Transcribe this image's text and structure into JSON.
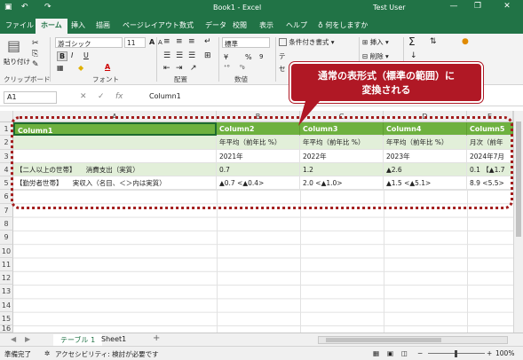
{
  "window": {
    "title": "Book1 - Excel",
    "user": "Test User",
    "minimize_glyph": "—",
    "restore_glyph": "❐",
    "close_glyph": "✕"
  },
  "ribbon_tabs": [
    "ファイル",
    "ホーム",
    "挿入",
    "描画",
    "ページレイアウト",
    "数式",
    "データ",
    "校閲",
    "表示",
    "ヘルプ"
  ],
  "tell_me": "何をしますか",
  "ribbon": {
    "paste_label": "貼り付け",
    "clipboard_label": "クリップボード",
    "font_name": "游ゴシック",
    "font_size": "11",
    "font_group_label": "フォント",
    "align_group_label": "配置",
    "number_format": "標準",
    "number_group_label": "数値",
    "conditional_format": "条件付き書式 ▾",
    "insert_label": "挿入 ▾",
    "delete_label": "削除 ▾",
    "cell_style_short": "セ",
    "table_format_short": "テ",
    "bold": "B",
    "italic": "I",
    "underline": "U",
    "sum_glyph": "Σ",
    "percent": "%",
    "accounting": "¥",
    "increase_font": "A",
    "decrease_font": "A",
    "font_color": "A",
    "fill_color": "◆",
    "accent_color": "#217346"
  },
  "formula_bar": {
    "name_box": "A1",
    "cancel_glyph": "✕",
    "enter_glyph": "✓",
    "fx_label": "fx",
    "content": "Column1"
  },
  "columns": [
    "A",
    "B",
    "C",
    "D",
    "E"
  ],
  "rows": [
    "1",
    "2",
    "3",
    "4",
    "5",
    "6",
    "7",
    "8",
    "9",
    "10",
    "11",
    "12",
    "13",
    "14",
    "15",
    "16"
  ],
  "table": {
    "header": [
      "Column1",
      "Column2",
      "Column3",
      "Column4",
      "Column5"
    ],
    "body": [
      [
        "",
        "年平均（前年比 %）",
        "年平均（前年比 %）",
        "年平均（前年比 %）",
        "月次（前年"
      ],
      [
        "",
        "2021年",
        "2022年",
        "2023年",
        "2024年7月"
      ],
      [
        "【二人以上の世帯】　　消費支出（実質）",
        "0.7",
        "1.2",
        "▲2.6",
        "0.1 【▲1.7"
      ],
      [
        "【勤労者世帯】　　実収入（名目、＜＞内は実質）",
        "▲0.7 <▲0.4>",
        "2.0 <▲1.0>",
        "▲1.5 <▲5.1>",
        "8.9 <5.5>"
      ]
    ]
  },
  "sheet_tabs": [
    "テーブル 1",
    "Sheet1"
  ],
  "add_sheet_glyph": "+",
  "status": {
    "ready": "準備完了",
    "accessibility": "アクセシビリティ: 検討が必要です",
    "zoom": "100%"
  },
  "callout": {
    "line1": "通常の表形式（標準の範囲）に",
    "line2": "変換される"
  }
}
